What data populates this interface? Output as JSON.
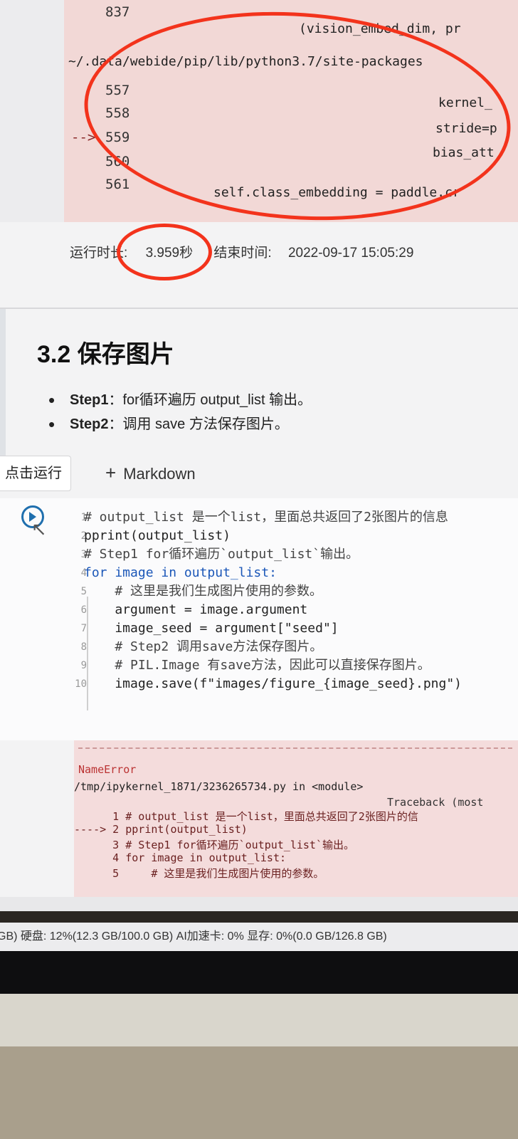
{
  "top_output": {
    "path_line": "~/.data/webide/pip/lib/python3.7/site-packages",
    "lines": [
      {
        "num": "837",
        "code": "(vision_embed_dim, pr"
      },
      {
        "num": "557",
        "code": "kernel_"
      },
      {
        "num": "558",
        "code": "stride=p"
      },
      {
        "num": "559",
        "code": "bias_att"
      },
      {
        "num": "560",
        "code": ""
      },
      {
        "num": "561",
        "code": "self.class_embedding = paddle.cr"
      }
    ],
    "arrow": "-->"
  },
  "run_info": {
    "duration_label": "运行时长:",
    "duration_value": "3.959秒",
    "end_label": "结束时间:",
    "end_value": "2022-09-17 15:05:29"
  },
  "section": {
    "title": "3.2 保存图片",
    "steps": [
      {
        "label": "Step1",
        "text": "：for循环遍历 output_list 输出。"
      },
      {
        "label": "Step2",
        "text": "：调用 save 方法保存图片。"
      }
    ]
  },
  "toolbar": {
    "run_label": "点击运行",
    "markdown_label": "Markdown",
    "plus": "+"
  },
  "code_cell": {
    "line_numbers": [
      "1",
      "2",
      "3",
      "4",
      "5",
      "6",
      "7",
      "8",
      "9",
      "10"
    ],
    "lines": [
      "# output_list 是一个list，里面总共返回了2张图片的信息",
      "pprint(output_list)",
      "# Step1 for循环遍历`output_list`输出。",
      "for image in output_list:",
      "    # 这里是我们生成图片使用的参数。",
      "    argument = image.argument",
      "    image_seed = argument[\"seed\"]",
      "    # Step2 调用save方法保存图片。",
      "    # PIL.Image 有save方法，因此可以直接保存图片。",
      "    image.save(f\"images/figure_{image_seed}.png\")"
    ]
  },
  "error_output": {
    "name": "NameError",
    "traceback": "Traceback (most",
    "file": "/tmp/ipykernel_1871/3236265734.py in <module>",
    "lines": [
      "      1 # output_list 是一个list，里面总共返回了2张图片的信",
      "----> 2 pprint(output_list)",
      "      3 # Step1 for循环遍历`output_list`输出。",
      "      4 for image in output_list:",
      "      5     # 这里是我们生成图片使用的参数。"
    ]
  },
  "status_bar": "GB) 硬盘: 12%(12.3 GB/100.0 GB) AI加速卡: 0%  显存: 0%(0.0 GB/126.8 GB)",
  "colors": {
    "marker": "#f3331c",
    "keyword": "#1b57b8",
    "error_bg": "#f2d8d6"
  }
}
